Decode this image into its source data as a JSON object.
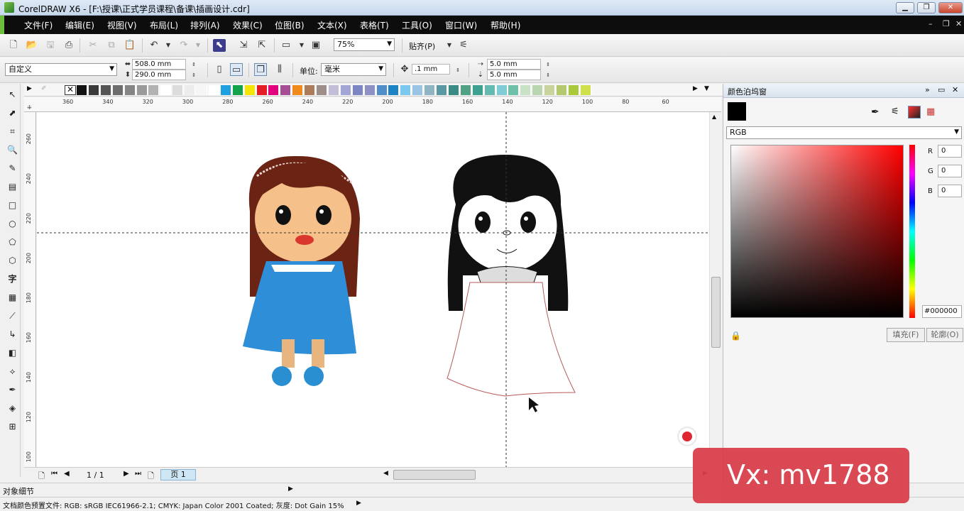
{
  "window": {
    "title": "CorelDRAW X6 - [F:\\授课\\正式学员课程\\备课\\插画设计.cdr]"
  },
  "menu": [
    "文件(F)",
    "编辑(E)",
    "视图(V)",
    "布局(L)",
    "排列(A)",
    "效果(C)",
    "位图(B)",
    "文本(X)",
    "表格(T)",
    "工具(O)",
    "窗口(W)",
    "帮助(H)"
  ],
  "toolbar": {
    "zoom": "75%",
    "snap_label": "贴齐(P)"
  },
  "propbar": {
    "page_preset": "自定义",
    "width": "508.0 mm",
    "height": "290.0 mm",
    "unit_label": "单位:",
    "unit": "毫米",
    "nudge": ".1 mm",
    "dup_x": "5.0 mm",
    "dup_y": "5.0 mm"
  },
  "ruler": {
    "h_ticks": [
      "360",
      "340",
      "320",
      "300",
      "280",
      "260",
      "240",
      "220",
      "200",
      "180",
      "160",
      "140",
      "120",
      "100",
      "80",
      "60"
    ],
    "v_ticks": [
      "260",
      "240",
      "220",
      "200",
      "180",
      "160",
      "140",
      "120",
      "100"
    ]
  },
  "palette_colors": [
    "#111111",
    "#3a3a3a",
    "#555555",
    "#6d6d6d",
    "#858585",
    "#9a9a9a",
    "#b2b2b2",
    "#ffffff",
    "#dcdcdc",
    "#ececec",
    "#f6f6f6",
    "#ffffff",
    "#1fa0e0",
    "#14a34a",
    "#f6e500",
    "#e41d24",
    "#e3007e",
    "#a64d96",
    "#f08a1c",
    "#ad7c5a",
    "#9e8e8a",
    "#c3bdd8",
    "#a3a6d4",
    "#7d86c4",
    "#8e8fc2",
    "#4f8ec9",
    "#1c84c6",
    "#7cc7ee",
    "#99c4e6",
    "#8fb5c3",
    "#5a99a3",
    "#3a8a85",
    "#51a285",
    "#3ea08e",
    "#64b9b0",
    "#7fcbd6",
    "#6fc0a8",
    "#c7e2c5",
    "#b9d6b1",
    "#c7d49b",
    "#b4c86e",
    "#a9c93a",
    "#cfe04a"
  ],
  "page_nav": {
    "page_count": "1 / 1",
    "page_tab": "页 1"
  },
  "status": {
    "object_details": "对象细节",
    "color_profile": "文档颜色预置文件: RGB: sRGB IEC61966-2.1; CMYK: Japan Color 2001 Coated; 灰度: Dot Gain 15%"
  },
  "docker": {
    "title": "颜色泊坞窗",
    "model": "RGB",
    "r_label": "R",
    "r": "0",
    "g_label": "G",
    "g": "0",
    "b_label": "B",
    "b": "0",
    "hex": "#000000",
    "fill_btn": "填充(F)",
    "outline_btn": "轮廓(O)"
  },
  "watermark": "Vx: mv1788"
}
